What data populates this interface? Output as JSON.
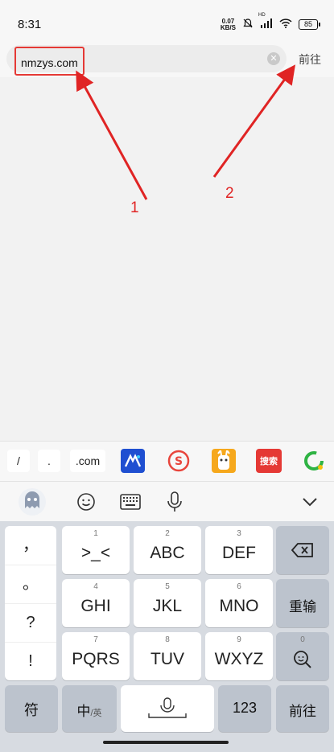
{
  "status": {
    "time": "8:31",
    "net_speed_value": "0.07",
    "net_speed_unit": "KB/S",
    "signal_type": "HD",
    "battery": "85"
  },
  "browser": {
    "url_value": "nmzys.com",
    "go_label": "前往"
  },
  "annotations": [
    {
      "label": "1"
    },
    {
      "label": "2"
    }
  ],
  "shortcuts": {
    "chips": [
      "/",
      ".",
      ".com"
    ],
    "sogou_label": "搜索"
  },
  "keyboard": {
    "punctuation": [
      "，",
      "。",
      "?",
      "!"
    ],
    "keys": [
      {
        "num": "1",
        "label": ">_<"
      },
      {
        "num": "2",
        "label": "ABC"
      },
      {
        "num": "3",
        "label": "DEF"
      },
      {
        "num": "4",
        "label": "GHI"
      },
      {
        "num": "5",
        "label": "JKL"
      },
      {
        "num": "6",
        "label": "MNO"
      },
      {
        "num": "7",
        "label": "PQRS"
      },
      {
        "num": "8",
        "label": "TUV"
      },
      {
        "num": "9",
        "label": "WXYZ"
      }
    ],
    "retype_label": "重输",
    "zero_num": "0",
    "symbols_label": "符",
    "zh_label": "中",
    "en_label": "/英",
    "numbers_label": "123",
    "enter_label": "前往"
  }
}
